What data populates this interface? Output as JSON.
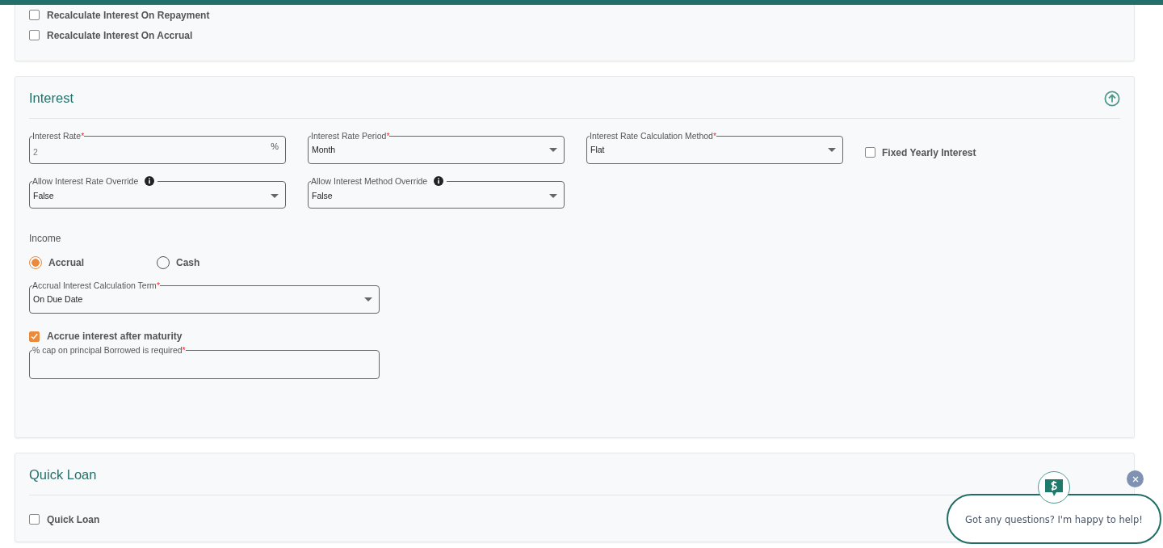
{
  "settings_card": {
    "checkboxes": [
      {
        "label": "Recalculate Interest On Repayment",
        "checked": false
      },
      {
        "label": "Recalculate Interest On Accrual",
        "checked": false
      }
    ]
  },
  "interest": {
    "title": "Interest",
    "expanded": true,
    "rows": [
      [
        {
          "kind": "text",
          "label": "Interest Rate",
          "required_mark": "*",
          "value": "2",
          "suffix": "%"
        },
        {
          "kind": "select",
          "label": "Interest Rate Period",
          "required_mark": "*",
          "value": "Month"
        },
        {
          "kind": "select",
          "label": "Interest Rate Calculation Method",
          "required_mark": "*",
          "value": "Flat"
        },
        {
          "kind": "checkbox",
          "label": "Fixed Yearly Interest",
          "checked": false
        }
      ],
      [
        {
          "kind": "select",
          "label": "Allow Interest Rate Override",
          "info": true,
          "value": "False"
        },
        {
          "kind": "select",
          "label": "Allow Interest Method Override",
          "info": true,
          "value": "False"
        }
      ]
    ],
    "income": {
      "label": "Income",
      "options": [
        {
          "label": "Accrual",
          "selected": true
        },
        {
          "label": "Cash",
          "selected": false
        }
      ]
    },
    "term_field": {
      "kind": "select",
      "label": "Accrual Interest Calculation Term",
      "required_mark": "*",
      "value": "On Due Date"
    },
    "after_maturity": {
      "label": "Accrue interest after maturity",
      "checked": true
    },
    "cap_field": {
      "kind": "text",
      "label": "% cap on principal Borrowed is required",
      "required_mark": "*"
    }
  },
  "quick_loan": {
    "title": "Quick Loan",
    "checkbox": {
      "label": "Quick Loan",
      "checked": false
    }
  },
  "chat": {
    "message": "Got any questions? I'm happy to help!"
  }
}
